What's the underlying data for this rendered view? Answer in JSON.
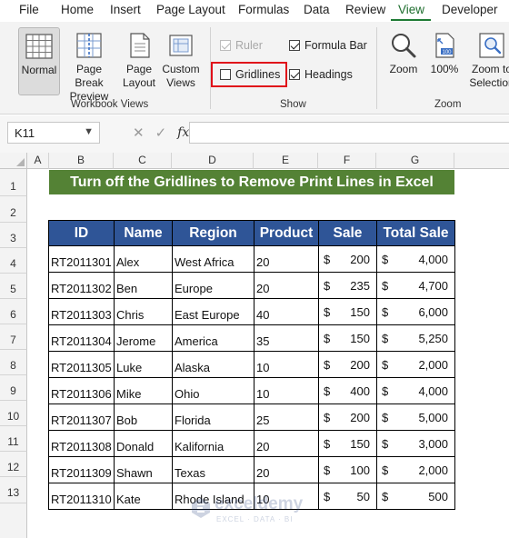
{
  "menu": {
    "tabs": [
      "File",
      "Home",
      "Insert",
      "Page Layout",
      "Formulas",
      "Data",
      "Review",
      "View",
      "Developer"
    ],
    "active_tab": "View"
  },
  "ribbon": {
    "workbook_views": {
      "label": "Workbook Views",
      "normal": "Normal",
      "page_break_1": "Page Break",
      "page_break_2": "Preview",
      "page_layout_1": "Page",
      "page_layout_2": "Layout",
      "custom_views_1": "Custom",
      "custom_views_2": "Views"
    },
    "show": {
      "label": "Show",
      "ruler": {
        "label": "Ruler",
        "checked": true,
        "disabled": true
      },
      "formula_bar": {
        "label": "Formula Bar",
        "checked": true
      },
      "gridlines": {
        "label": "Gridlines",
        "checked": false
      },
      "headings": {
        "label": "Headings",
        "checked": true
      }
    },
    "zoom": {
      "label": "Zoom",
      "zoom": "Zoom",
      "zoom100": "100%",
      "zoom_sel_1": "Zoom to",
      "zoom_sel_2": "Selection"
    },
    "highlight_color": "#e0101a"
  },
  "formula_bar": {
    "name_box": "K11",
    "fx": "fx",
    "cancel": "✕",
    "enter": "✓",
    "formula": ""
  },
  "sheet": {
    "columns": [
      "A",
      "B",
      "C",
      "D",
      "E",
      "F",
      "G"
    ],
    "rows": [
      "1",
      "2",
      "3",
      "4",
      "5",
      "6",
      "7",
      "8",
      "9",
      "10",
      "11",
      "12",
      "13"
    ],
    "title": "Turn off the Gridlines to Remove Print Lines in Excel",
    "title_bg": "#548235",
    "header_bg": "#2f5597",
    "table": {
      "headers": [
        "ID",
        "Name",
        "Region",
        "Product",
        "Sale",
        "Total Sale"
      ],
      "rows": [
        {
          "id": "RT2011301",
          "name": "Alex",
          "region": "West Africa",
          "product": "20",
          "sale": "200",
          "total": "4,000"
        },
        {
          "id": "RT2011302",
          "name": "Ben",
          "region": "Europe",
          "product": "20",
          "sale": "235",
          "total": "4,700"
        },
        {
          "id": "RT2011303",
          "name": "Chris",
          "region": "East Europe",
          "product": "40",
          "sale": "150",
          "total": "6,000"
        },
        {
          "id": "RT2011304",
          "name": "Jerome",
          "region": "America",
          "product": "35",
          "sale": "150",
          "total": "5,250"
        },
        {
          "id": "RT2011305",
          "name": "Luke",
          "region": "Alaska",
          "product": "10",
          "sale": "200",
          "total": "2,000"
        },
        {
          "id": "RT2011306",
          "name": "Mike",
          "region": "Ohio",
          "product": "10",
          "sale": "400",
          "total": "4,000"
        },
        {
          "id": "RT2011307",
          "name": "Bob",
          "region": "Florida",
          "product": "25",
          "sale": "200",
          "total": "5,000"
        },
        {
          "id": "RT2011308",
          "name": "Donald",
          "region": "Kalifornia",
          "product": "20",
          "sale": "150",
          "total": "3,000"
        },
        {
          "id": "RT2011309",
          "name": "Shawn",
          "region": "Texas",
          "product": "20",
          "sale": "100",
          "total": "2,000"
        },
        {
          "id": "RT2011310",
          "name": "Kate",
          "region": "Rhode Island",
          "product": "10",
          "sale": "50",
          "total": "500"
        }
      ],
      "currency": "$"
    }
  },
  "watermark": {
    "name": "exceldemy",
    "tagline": "EXCEL · DATA · BI"
  }
}
